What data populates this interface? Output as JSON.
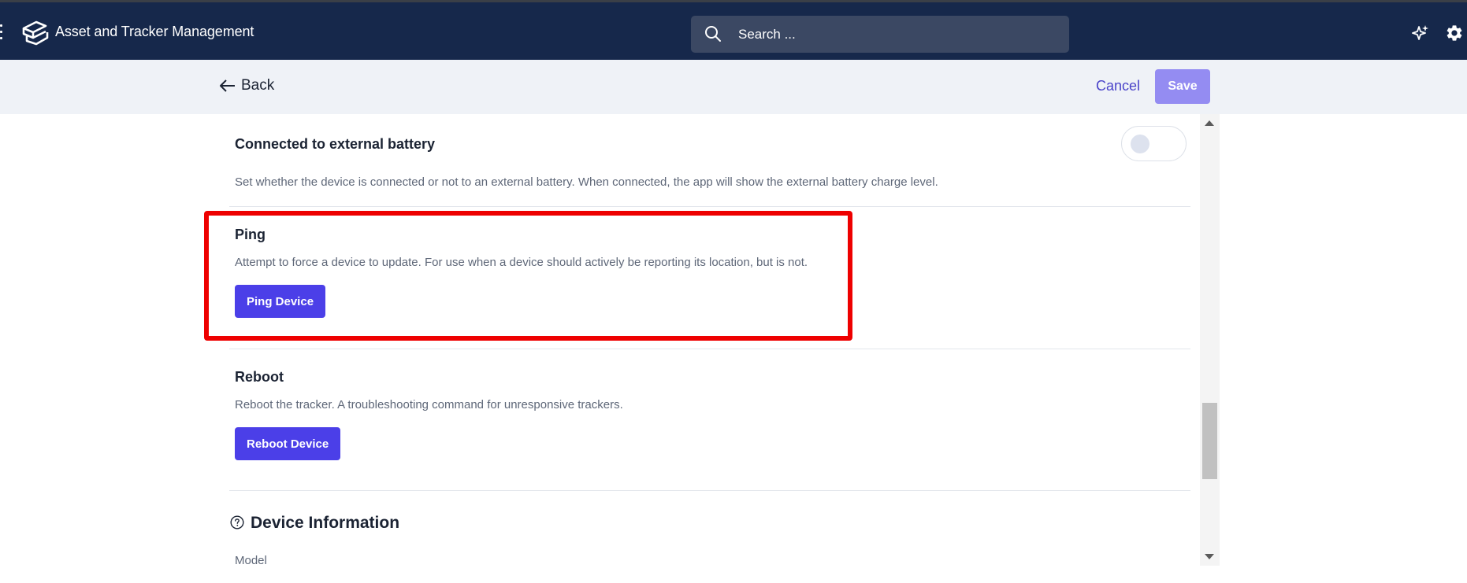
{
  "app": {
    "title": "Asset and Tracker Management"
  },
  "search": {
    "placeholder": "Search ..."
  },
  "header_icons": [
    "menu-icon",
    "app-logo-icon",
    "search-icon",
    "sparkle-icon",
    "gear-icon"
  ],
  "action_bar": {
    "back_label": "Back",
    "cancel_label": "Cancel",
    "save_label": "Save"
  },
  "sections": {
    "external_battery": {
      "title": "Connected to external battery",
      "description": "Set whether the device is connected or not to an external battery. When connected, the app will show the external battery charge level.",
      "toggle_on": false
    },
    "ping": {
      "title": "Ping",
      "description": "Attempt to force a device to update. For use when a device should actively be reporting its location, but is not.",
      "button_label": "Ping Device",
      "highlighted": true
    },
    "reboot": {
      "title": "Reboot",
      "description": "Reboot the tracker. A troubleshooting command for unresponsive trackers.",
      "button_label": "Reboot Device"
    },
    "device_information": {
      "title": "Device Information",
      "first_field_label": "Model"
    }
  },
  "colors": {
    "topbar": "#16284b",
    "search_box": "#3b4863",
    "action_bar": "#eff2f7",
    "primary_button": "#4b3fe8",
    "save_button_disabled": "#948cf2",
    "link": "#4a43c9",
    "highlight": "#ee0000"
  }
}
